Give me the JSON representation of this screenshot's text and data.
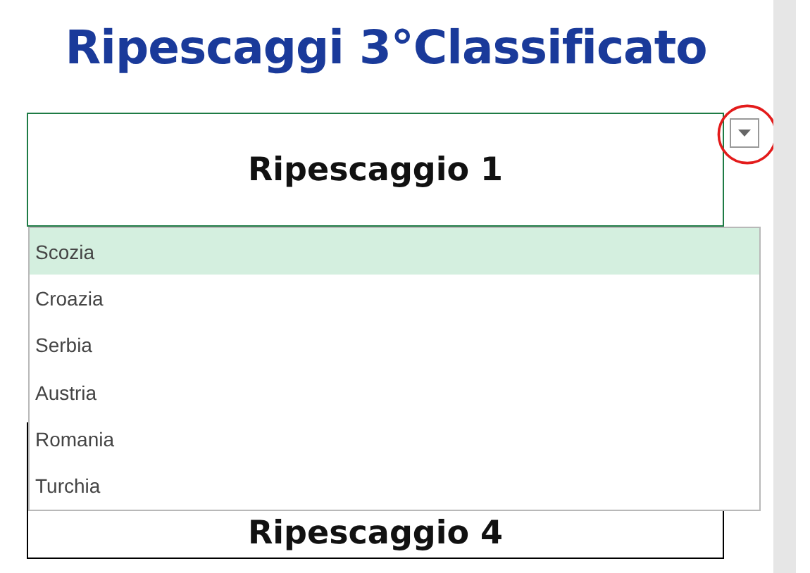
{
  "title": "Ripescaggi 3°Classificato",
  "cells": [
    {
      "label": "Ripescaggio 1",
      "active": true
    },
    {
      "label": "Ripescaggio 4",
      "active": false
    }
  ],
  "dropdown": {
    "items": [
      {
        "label": "Scozia",
        "selected": true
      },
      {
        "label": "Croazia",
        "selected": false
      },
      {
        "label": "Serbia",
        "selected": false
      },
      {
        "label": "Austria",
        "selected": false
      },
      {
        "label": "Romania",
        "selected": false
      },
      {
        "label": "Turchia",
        "selected": false
      }
    ]
  }
}
